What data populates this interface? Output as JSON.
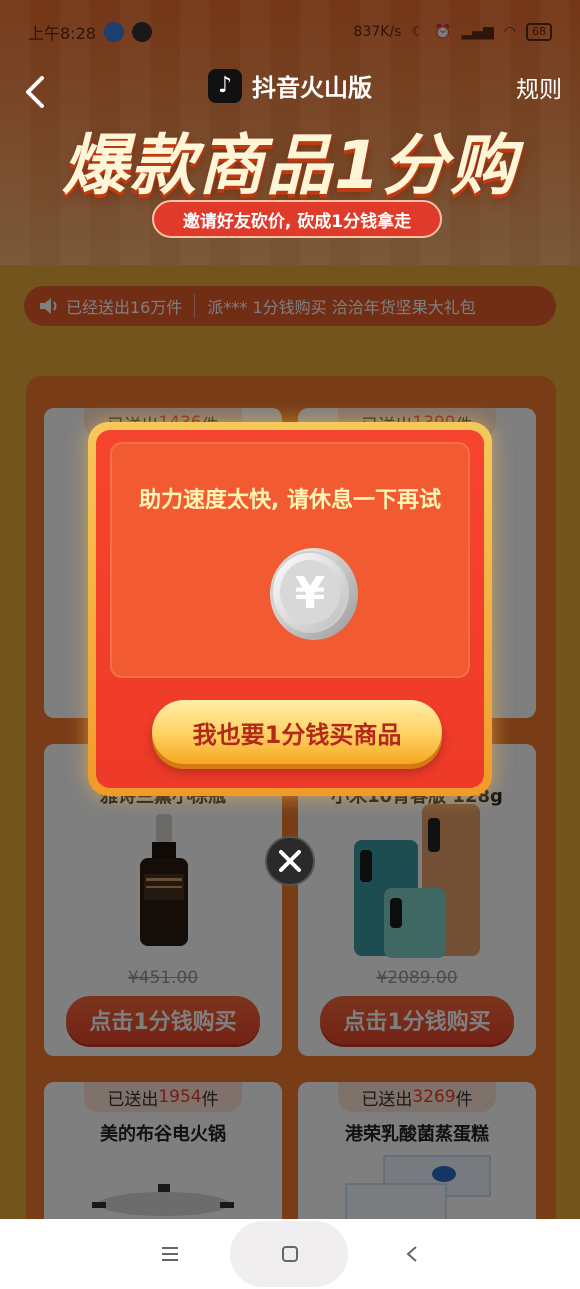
{
  "status_bar": {
    "time": "上午8:28",
    "net_speed": "837K/s",
    "battery": "68"
  },
  "header": {
    "app_name": "抖音火山版",
    "rules": "规则",
    "headline": "爆款商品1分购",
    "subtitle": "邀请好友砍价, 砍成1分钱拿走"
  },
  "ticker": {
    "count_text": "已经送出16万件",
    "message": "派*** 1分钱购买 洽洽年货坚果大礼包"
  },
  "products": [
    {
      "sold_prefix": "已送出",
      "sold_num": "1436",
      "sold_suffix": "件",
      "name": "",
      "price": "",
      "button": ""
    },
    {
      "sold_prefix": "已送出",
      "sold_num": "1399",
      "sold_suffix": "件",
      "name": "",
      "price": "",
      "button": ""
    },
    {
      "sold_prefix": "",
      "sold_num": "",
      "sold_suffix": "",
      "name": "雅诗兰黛小棕瓶",
      "price": "¥451.00",
      "button": "点击1分钱购买"
    },
    {
      "sold_prefix": "",
      "sold_num": "",
      "sold_suffix": "",
      "name": "小米10青春版 128g",
      "price": "¥2089.00",
      "button": "点击1分钱购买"
    },
    {
      "sold_prefix": "已送出",
      "sold_num": "1954",
      "sold_suffix": "件",
      "name": "美的布谷电火锅",
      "price": "",
      "button": ""
    },
    {
      "sold_prefix": "已送出",
      "sold_num": "3269",
      "sold_suffix": "件",
      "name": "港荣乳酸菌蒸蛋糕",
      "price": "",
      "button": ""
    }
  ],
  "modal": {
    "message": "助力速度太快, 请休息一下再试",
    "coin_symbol": "¥",
    "cta": "我也要1分钱买商品"
  },
  "icons": {
    "back": "back-arrow-icon",
    "speaker": "speaker-icon",
    "close": "close-icon",
    "nav_menu": "menu-icon",
    "nav_home": "home-icon",
    "nav_back": "back-icon"
  },
  "colors": {
    "accent": "#ee3a28",
    "gold": "#ffd060",
    "sold_num": "#ea3c2a"
  }
}
